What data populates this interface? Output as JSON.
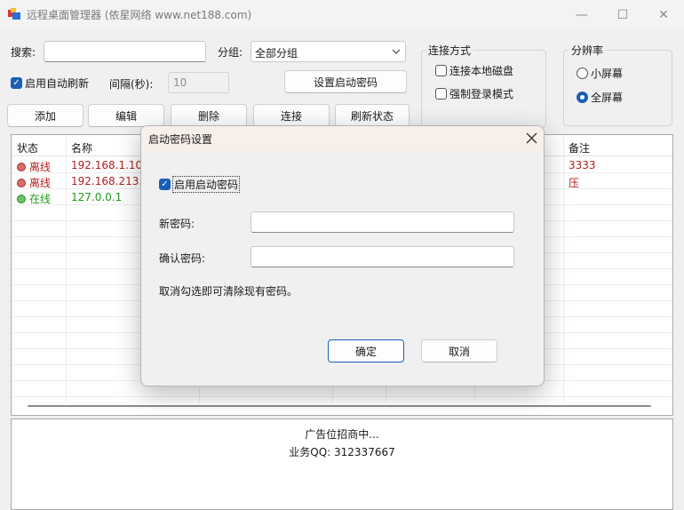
{
  "window": {
    "title": "远程桌面管理器   (依星网络 www.net188.com)",
    "minimize_glyph": "—",
    "maximize_glyph": "☐",
    "close_glyph": "✕"
  },
  "toolbar": {
    "search_label": "搜索:",
    "search_value": "",
    "group_label": "分组:",
    "group_selected": "全部分组",
    "auto_refresh_label": "启用自动刷新",
    "auto_refresh_checked": true,
    "interval_label": "间隔(秒):",
    "interval_value": "10",
    "set_password_button": "设置启动密码",
    "add_button": "添加",
    "edit_button": "编辑",
    "delete_button": "删除",
    "connect_button": "连接",
    "refresh_status_button": "刷新状态"
  },
  "connection_group": {
    "title": "连接方式",
    "local_disk_label": "连接本地磁盘",
    "local_disk_checked": false,
    "force_login_label": "强制登录模式",
    "force_login_checked": false
  },
  "resolution_group": {
    "title": "分辨率",
    "small_screen_label": "小屏幕",
    "full_screen_label": "全屏幕",
    "selected": "全屏幕"
  },
  "table": {
    "columns": [
      "状态",
      "名称",
      "备注"
    ],
    "rows": [
      {
        "status": "离线",
        "name": "192.168.1.100",
        "note": "3333",
        "online": false
      },
      {
        "status": "离线",
        "name": "192.168.213.1",
        "note": "压",
        "online": false
      },
      {
        "status": "在线",
        "name": "127.0.0.1",
        "note": "",
        "online": true
      }
    ]
  },
  "ad": {
    "line1": "广告位招商中...",
    "line2": "业务QQ:  312337667"
  },
  "dialog": {
    "title": "启动密码设置",
    "enable_label": "启用启动密码",
    "enable_checked": true,
    "new_password_label": "新密码:",
    "new_password_value": "",
    "confirm_password_label": "确认密码:",
    "confirm_password_value": "",
    "hint": "取消勾选即可清除现有密码。",
    "ok_button": "确定",
    "cancel_button": "取消"
  },
  "colors": {
    "accent": "#1a5fb4",
    "offline": "#b01e1e",
    "online": "#1e9a1e",
    "dialog_title_bg": "#f8efea"
  }
}
